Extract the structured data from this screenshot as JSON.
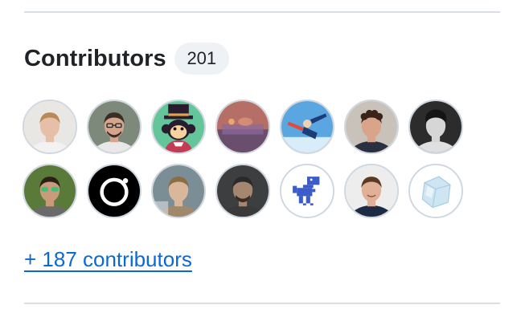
{
  "contributors": {
    "title": "Contributors",
    "count": "201",
    "more_link": "+ 187 contributors",
    "avatars": [
      {
        "kind": "photo-face",
        "bg": "#e9e7e4",
        "skin": "#e5bfa8",
        "hair": "#b88959",
        "shirt": "#f2f2f2"
      },
      {
        "kind": "photo-face-glasses",
        "bg": "#7d8a7b",
        "skin": "#d6a58b",
        "hair": "#3b2c24",
        "shirt": "#e8e8e8"
      },
      {
        "kind": "cartoon-monkey-hat",
        "bg": "#64c49a",
        "skin": "#f6d2a0",
        "hair": "#2a1c2f",
        "shirt": "#c53b55"
      },
      {
        "kind": "photo-blur",
        "bg": "#b66f66",
        "skin": "#d48b78",
        "hair": "#6a4e6e",
        "shirt": "#8a6aa0"
      },
      {
        "kind": "photo-sky",
        "bg": "#5aa6e0",
        "skin": "#f0d0b0",
        "hair": "#1e3c76",
        "shirt": "#e24a3b"
      },
      {
        "kind": "photo-face-curly",
        "bg": "#c9c2bb",
        "skin": "#d8a48a",
        "hair": "#3a2419",
        "shirt": "#2a3040"
      },
      {
        "kind": "photo-bw",
        "bg": "#2c2c2c",
        "skin": "#d6d6d6",
        "hair": "#151515",
        "shirt": "#e0e0e0"
      },
      {
        "kind": "photo-sunglasses",
        "bg": "#5a7a3a",
        "skin": "#c99b7a",
        "hair": "#2a2015",
        "shirt": "#6a6a6a"
      },
      {
        "kind": "logo-ring",
        "bg": "#000000",
        "skin": "#ffffff",
        "hair": "#ffffff",
        "shirt": "#000000"
      },
      {
        "kind": "photo-face-dim",
        "bg": "#7b8e95",
        "skin": "#d8b79a",
        "hair": "#8a6c45",
        "shirt": "#a0886a"
      },
      {
        "kind": "photo-face-dark",
        "bg": "#3d3e3f",
        "skin": "#a58670",
        "hair": "#2a2a2a",
        "shirt": "#3a3a3a"
      },
      {
        "kind": "pixel-dino",
        "bg": "#ffffff",
        "skin": "#3c5dc9",
        "hair": "#3c5dc9",
        "shirt": "#3c5dc9"
      },
      {
        "kind": "photo-face-smile",
        "bg": "#ededed",
        "skin": "#e0b196",
        "hair": "#5a3a20",
        "shirt": "#1f2b44"
      },
      {
        "kind": "ice-cube",
        "bg": "#ffffff",
        "skin": "#cfe6f2",
        "hair": "#a9cfe4",
        "shirt": "#e9f4fa"
      }
    ]
  }
}
